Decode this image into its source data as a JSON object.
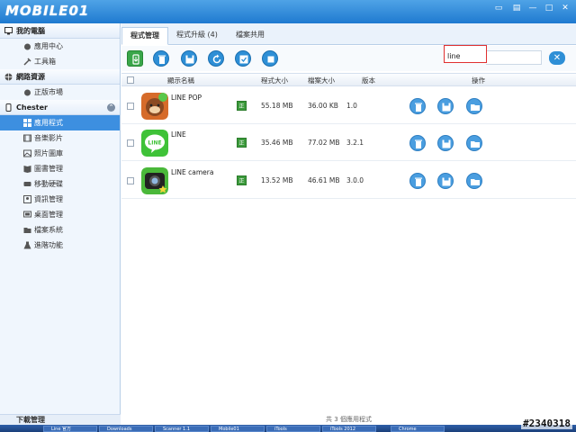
{
  "app": {
    "logo": "MOBILE01"
  },
  "sidebar": {
    "groups": [
      {
        "label": "我的電腦",
        "items": [
          {
            "label": "應用中心"
          },
          {
            "label": "工具箱"
          }
        ]
      },
      {
        "label": "網路資源",
        "items": [
          {
            "label": "正版市場"
          }
        ]
      },
      {
        "label": "Chester",
        "items": [
          {
            "label": "應用程式"
          },
          {
            "label": "音樂影片"
          },
          {
            "label": "照片圖庫"
          },
          {
            "label": "圖書管理"
          },
          {
            "label": "移動硬碟"
          },
          {
            "label": "資訊管理"
          },
          {
            "label": "桌面管理"
          },
          {
            "label": "檔案系統"
          },
          {
            "label": "進階功能"
          }
        ]
      }
    ],
    "footer": "下載管理"
  },
  "tabs": [
    {
      "label": "程式管理"
    },
    {
      "label": "程式升級 (4)"
    },
    {
      "label": "檔案共用"
    }
  ],
  "search": {
    "value": "line"
  },
  "table": {
    "headers": {
      "name": "顯示名稱",
      "app_size": "程式大小",
      "data_size": "檔案大小",
      "version": "版本",
      "actions": "操作"
    },
    "rows": [
      {
        "name": "LINE POP",
        "badge": "正",
        "app_size": "55.18 MB",
        "data_size": "36.00 KB",
        "version": "1.0"
      },
      {
        "name": "LINE",
        "badge": "正",
        "app_size": "35.46 MB",
        "data_size": "77.02 MB",
        "version": "3.2.1"
      },
      {
        "name": "LINE camera",
        "badge": "正",
        "app_size": "13.52 MB",
        "data_size": "46.61 MB",
        "version": "3.0.0"
      }
    ]
  },
  "status": "共 3 個應用程式",
  "taskbar": [
    "Line 官方",
    "Downloads",
    "Scanner 1.1",
    "Mobile01",
    "iTools",
    "iTools 2012",
    "Chrome"
  ],
  "watermark": "#2340318"
}
